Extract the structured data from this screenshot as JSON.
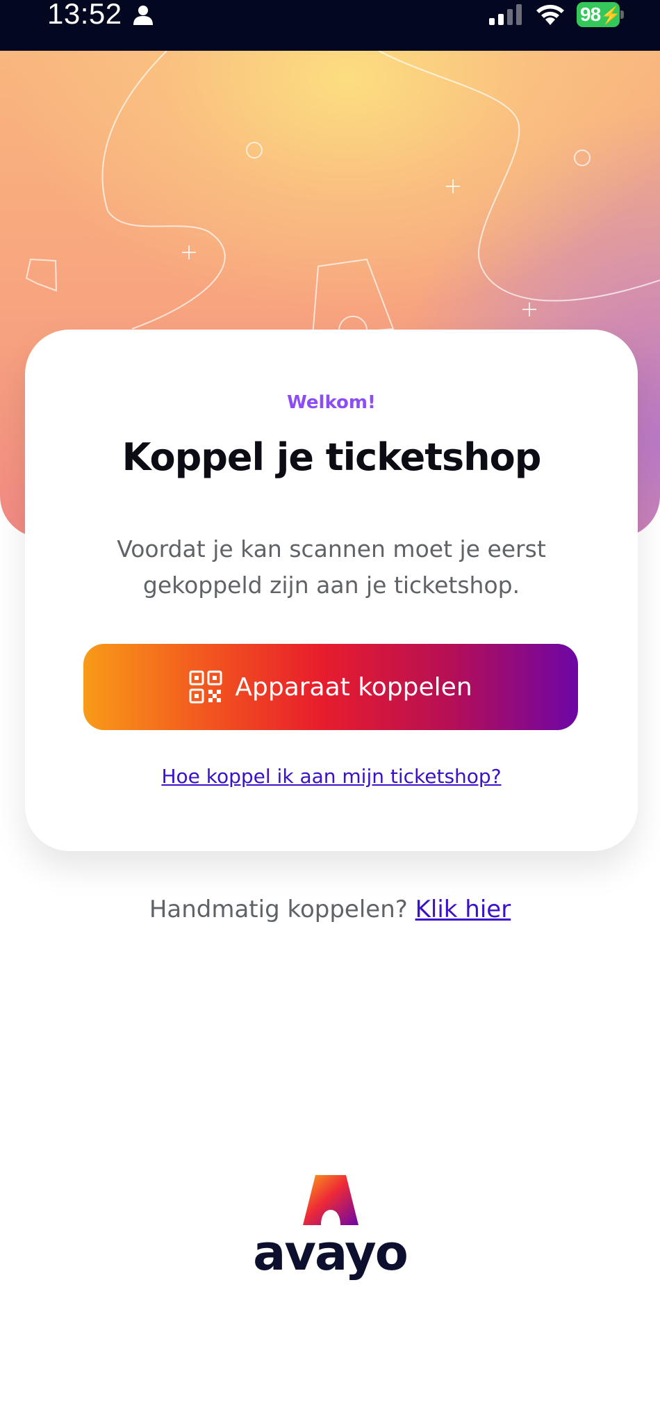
{
  "status_bar": {
    "time": "13:52",
    "battery": "98",
    "icons": [
      "person-icon",
      "signal-icon",
      "wifi-icon",
      "battery-icon"
    ]
  },
  "card": {
    "welcome": "Welkom!",
    "title": "Koppel je ticketshop",
    "description": "Voordat je kan scannen moet je eerst gekoppeld zijn aan je ticketshop.",
    "button_label": "Apparaat koppelen",
    "button_icon": "qr-code-icon",
    "help_link": "Hoe koppel ik aan mijn ticketshop?"
  },
  "manual": {
    "text": "Handmatig koppelen?",
    "link": "Klik hier"
  },
  "brand": {
    "name": "avayo"
  },
  "colors": {
    "accent_purple": "#8b4df5",
    "link_blue": "#3a10c9",
    "gradient_start": "#f89b18",
    "gradient_mid": "#e81d2c",
    "gradient_end": "#6d06a6",
    "status_bar_bg": "#030820",
    "battery_green": "#34c759"
  }
}
